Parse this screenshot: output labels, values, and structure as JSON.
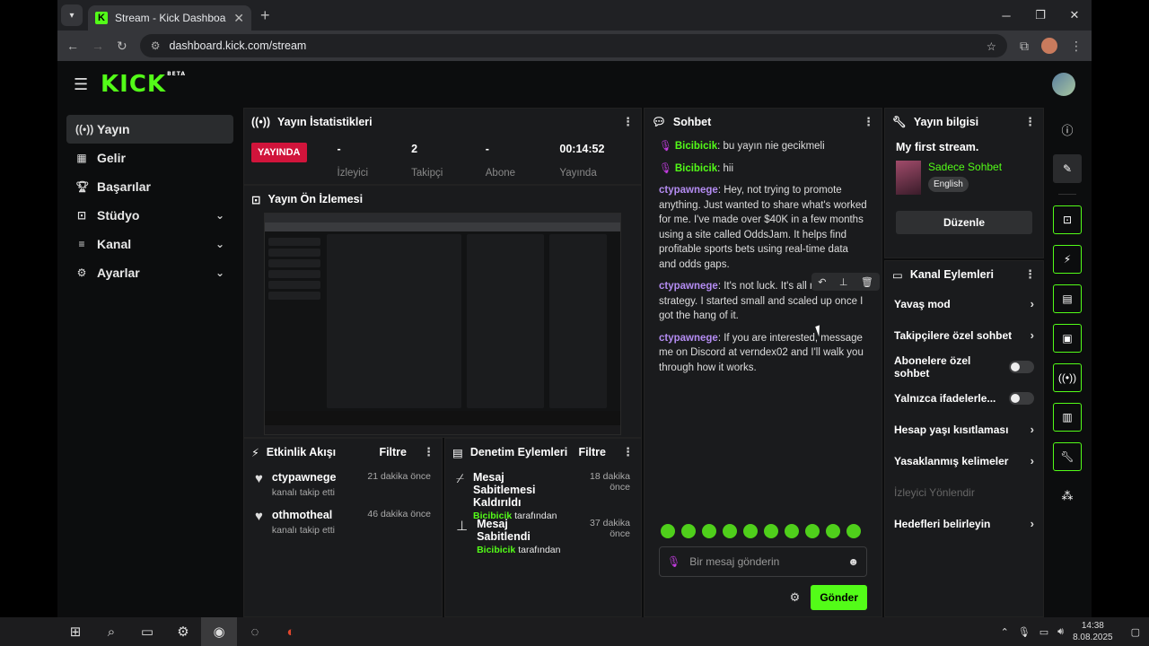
{
  "browser": {
    "tab_title": "Stream - Kick Dashboard",
    "url": "dashboard.kick.com/stream"
  },
  "app": {
    "logo": "KICK",
    "beta": "BETA"
  },
  "sidebar": {
    "items": [
      {
        "label": "Yayın",
        "icon": "broadcast-icon"
      },
      {
        "label": "Gelir",
        "icon": "revenue-icon"
      },
      {
        "label": "Başarılar",
        "icon": "trophy-icon"
      },
      {
        "label": "Stüdyo",
        "icon": "studio-icon"
      },
      {
        "label": "Kanal",
        "icon": "channel-icon"
      },
      {
        "label": "Ayarlar",
        "icon": "settings-icon"
      }
    ]
  },
  "stats_panel": {
    "title": "Yayın İstatistikleri",
    "live_label": "YAYINDA",
    "stats": [
      {
        "value": "-",
        "label": "İzleyici"
      },
      {
        "value": "2",
        "label": "Takipçi"
      },
      {
        "value": "-",
        "label": "Abone"
      },
      {
        "value": "00:14:52",
        "label": "Yayında"
      }
    ]
  },
  "preview_panel": {
    "title": "Yayın Ön İzlemesi"
  },
  "activity_panel": {
    "title": "Etkinlik Akışı",
    "filter": "Filtre",
    "items": [
      {
        "name": "ctypawnege",
        "sub": "kanalı takip etti",
        "time": "21 dakika önce"
      },
      {
        "name": "othmotheal",
        "sub": "kanalı takip etti",
        "time": "46 dakika önce"
      }
    ]
  },
  "moderation_panel": {
    "title": "Denetim Eylemleri",
    "filter": "Filtre",
    "items": [
      {
        "action": "Mesaj Sabitlemesi Kaldırıldı",
        "user": "Bicibicik",
        "suffix": "tarafından",
        "time": "18 dakika önce"
      },
      {
        "action": "Mesaj Sabitlendi",
        "user": "Bicibicik",
        "suffix": "tarafından",
        "time": "37 dakika önce"
      }
    ]
  },
  "chat": {
    "title": "Sohbet",
    "messages": [
      {
        "user": "Bicibicik",
        "text": ": bu yayın nie gecikmeli",
        "color": "#53fc18",
        "badge": true
      },
      {
        "user": "Bicibicik",
        "text": ": hii",
        "color": "#53fc18",
        "badge": true
      },
      {
        "user": "ctypawnege",
        "text": ": Hey, not trying to promote anything. Just wanted to share what's worked for me. I've made over $40K in a few months using a site called OddsJam. It helps find profitable sports bets using real-time data and odds gaps.",
        "color": "#b48cf2",
        "badge": false
      },
      {
        "user": "ctypawnege",
        "text": ": It's not luck. It's all math and strategy. I started small and scaled up once I got the hang of it.",
        "color": "#b48cf2",
        "badge": false
      },
      {
        "user": "ctypawnege",
        "text": ": If you are interested, message me on Discord at verndex02 and I'll walk you through how it works.",
        "color": "#b48cf2",
        "badge": false
      }
    ],
    "placeholder": "Bir mesaj gönderin",
    "send": "Gönder"
  },
  "stream_info": {
    "title": "Yayın bilgisi",
    "stream_title": "My first stream.",
    "category": "Sadece Sohbet",
    "language": "English",
    "edit": "Düzenle"
  },
  "channel_actions": {
    "title": "Kanal Eylemleri",
    "items": [
      {
        "label": "Yavaş mod",
        "type": "chevron"
      },
      {
        "label": "Takipçilere özel sohbet",
        "type": "chevron"
      },
      {
        "label": "Abonelere özel sohbet",
        "type": "toggle"
      },
      {
        "label": "Yalnızca ifadelerle...",
        "type": "toggle"
      },
      {
        "label": "Hesap yaşı kısıtlaması",
        "type": "chevron"
      },
      {
        "label": "Yasaklanmış kelimeler",
        "type": "chevron"
      },
      {
        "label": "İzleyici Yönlendir",
        "type": "disabled"
      },
      {
        "label": "Hedefleri belirleyin",
        "type": "chevron"
      }
    ]
  },
  "taskbar": {
    "time": "14:38",
    "date": "8.08.2025"
  },
  "colors": {
    "accent": "#53fc18",
    "live": "#d1143b"
  }
}
